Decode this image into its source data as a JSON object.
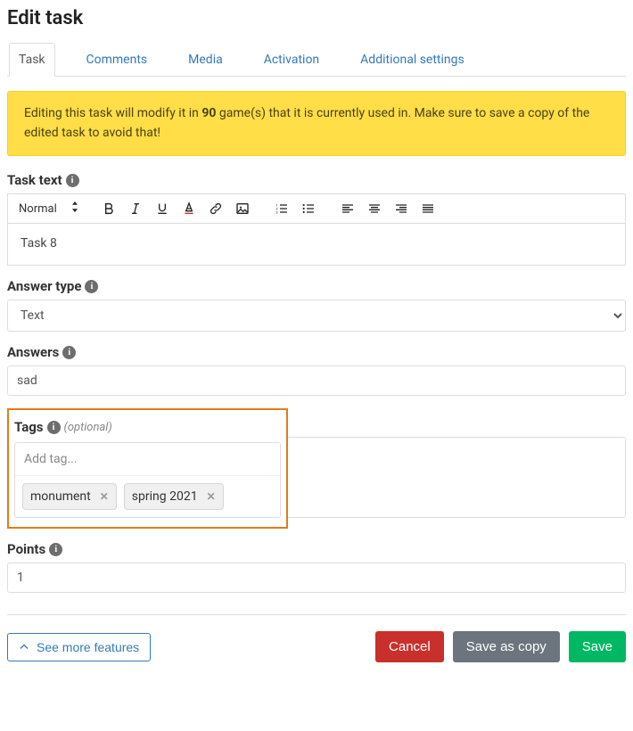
{
  "title": "Edit task",
  "tabs": [
    {
      "label": "Task",
      "active": true
    },
    {
      "label": "Comments",
      "active": false
    },
    {
      "label": "Media",
      "active": false
    },
    {
      "label": "Activation",
      "active": false
    },
    {
      "label": "Additional settings",
      "active": false
    }
  ],
  "alert": {
    "prefix": "Editing this task will modify it in ",
    "count": "90",
    "suffix": " game(s) that it is currently used in. Make sure to save a copy of the edited task to avoid that!"
  },
  "task_text": {
    "label": "Task text",
    "format_label": "Normal",
    "body": "Task 8"
  },
  "answer_type": {
    "label": "Answer type",
    "selected": "Text"
  },
  "answers": {
    "label": "Answers",
    "value": "sad"
  },
  "tags": {
    "label": "Tags",
    "optional": "(optional)",
    "placeholder": "Add tag...",
    "items": [
      "monument",
      "spring 2021"
    ]
  },
  "points": {
    "label": "Points",
    "value": "1"
  },
  "footer": {
    "more": "See more features",
    "cancel": "Cancel",
    "save_copy": "Save as copy",
    "save": "Save"
  }
}
